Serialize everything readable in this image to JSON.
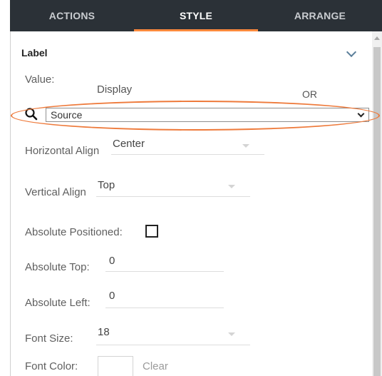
{
  "tabs": [
    {
      "label": "ACTIONS",
      "active": false
    },
    {
      "label": "STYLE",
      "active": true
    },
    {
      "label": "ARRANGE",
      "active": false
    }
  ],
  "section": {
    "title": "Label",
    "expanded": true
  },
  "value": {
    "label": "Value:",
    "display_label": "Display",
    "or_label": "OR",
    "source_value": "Source"
  },
  "horizontal_align": {
    "label": "Horizontal Align",
    "value": "Center"
  },
  "vertical_align": {
    "label": "Vertical Align",
    "value": "Top"
  },
  "absolute_positioned": {
    "label": "Absolute Positioned:",
    "checked": false
  },
  "absolute_top": {
    "label": "Absolute Top:",
    "value": "0"
  },
  "absolute_left": {
    "label": "Absolute Left:",
    "value": "0"
  },
  "font_size": {
    "label": "Font Size:",
    "value": "18"
  },
  "font_color": {
    "label": "Font Color:",
    "clear_label": "Clear"
  },
  "colors": {
    "tab_bar": "#2b3137",
    "accent": "#ff8a3d",
    "highlight": "#ee7a3b"
  }
}
